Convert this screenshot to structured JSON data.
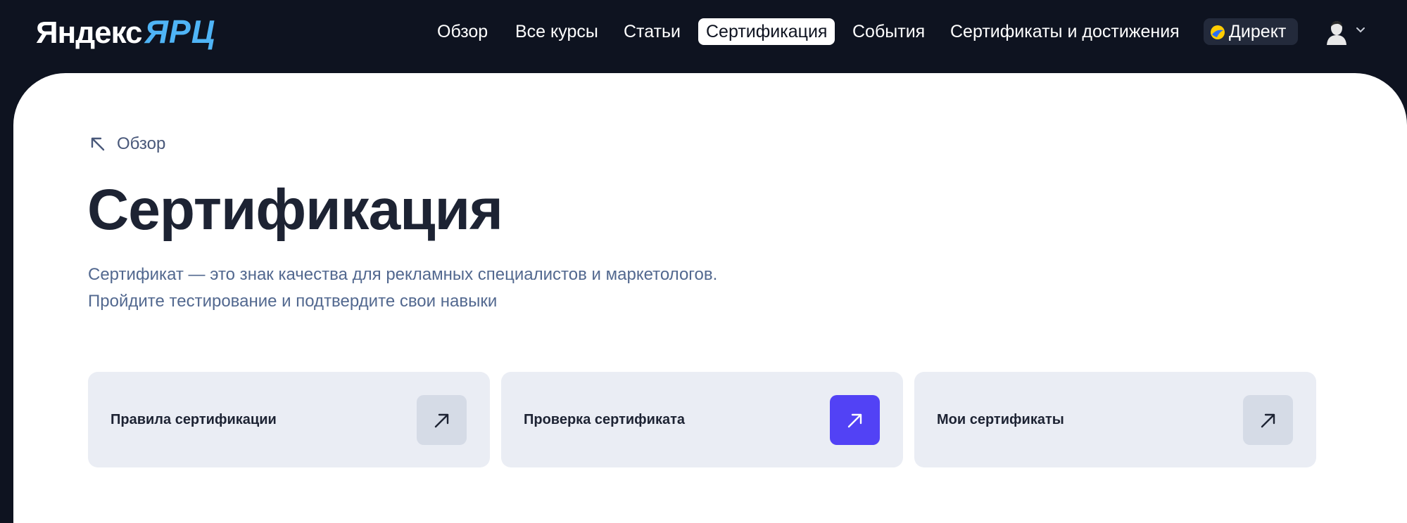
{
  "header": {
    "logo_main": "Яндекс",
    "logo_sub": "ЯРЦ",
    "nav": [
      {
        "label": "Обзор",
        "active": false
      },
      {
        "label": "Все курсы",
        "active": false
      },
      {
        "label": "Статьи",
        "active": false
      },
      {
        "label": "Сертификация",
        "active": true
      },
      {
        "label": "События",
        "active": false
      },
      {
        "label": "Сертификаты и достижения",
        "active": false
      }
    ],
    "direkt_label": "Директ",
    "direkt_icon": "yandex-direct-icon",
    "avatar_icon": "user-avatar-icon",
    "chevron_icon": "chevron-down-icon"
  },
  "page": {
    "back_label": "Обзор",
    "back_icon": "arrow-up-left-icon",
    "title": "Сертификация",
    "description_line1": "Сертификат — это знак качества для рекламных специалистов и маркетологов.",
    "description_line2": "Пройдите тестирование и подтвердите свои навыки"
  },
  "cards": [
    {
      "label": "Правила сертификации",
      "icon": "arrow-up-right-icon",
      "accent": false
    },
    {
      "label": "Проверка сертификата",
      "icon": "arrow-up-right-icon",
      "accent": true
    },
    {
      "label": "Мои сертификаты",
      "icon": "arrow-up-right-icon",
      "accent": false
    }
  ],
  "colors": {
    "header_bg": "#0e1320",
    "logo_accent": "#4fb4f6",
    "accent_button": "#5242f5",
    "card_bg": "#eaedf4",
    "text_dark": "#1d2333",
    "text_muted": "#52688f"
  }
}
